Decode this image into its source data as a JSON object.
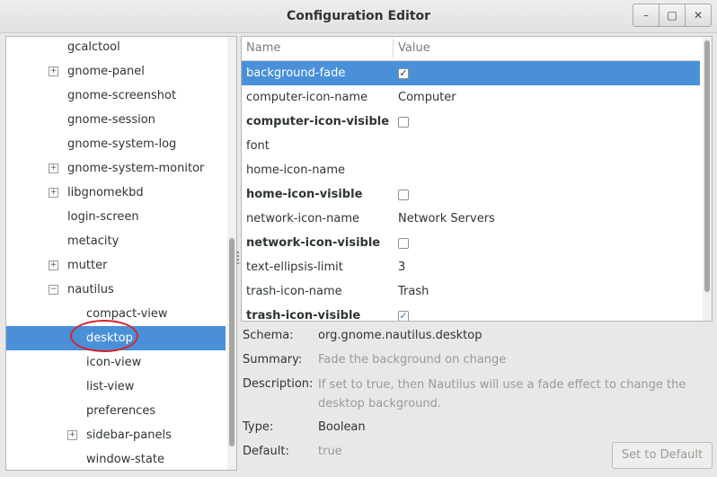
{
  "window": {
    "title": "Configuration Editor",
    "buttons": [
      {
        "name": "minimize",
        "glyph": "–"
      },
      {
        "name": "maximize",
        "glyph": "□"
      },
      {
        "name": "close",
        "glyph": "✕"
      }
    ]
  },
  "tree": {
    "items": [
      {
        "label": "gcalctool",
        "expander": false,
        "indent": 0
      },
      {
        "label": "gnome-panel",
        "expander": true,
        "indent": 0
      },
      {
        "label": "gnome-screenshot",
        "expander": false,
        "indent": 0
      },
      {
        "label": "gnome-session",
        "expander": false,
        "indent": 0
      },
      {
        "label": "gnome-system-log",
        "expander": false,
        "indent": 0
      },
      {
        "label": "gnome-system-monitor",
        "expander": true,
        "indent": 0
      },
      {
        "label": "libgnomekbd",
        "expander": true,
        "indent": 0
      },
      {
        "label": "login-screen",
        "expander": false,
        "indent": 0
      },
      {
        "label": "metacity",
        "expander": false,
        "indent": 0
      },
      {
        "label": "mutter",
        "expander": true,
        "indent": 0
      },
      {
        "label": "nautilus",
        "expander": "expanded",
        "indent": 0
      },
      {
        "label": "compact-view",
        "expander": false,
        "indent": 1
      },
      {
        "label": "desktop",
        "expander": false,
        "indent": 1,
        "selected": true
      },
      {
        "label": "icon-view",
        "expander": false,
        "indent": 1
      },
      {
        "label": "list-view",
        "expander": false,
        "indent": 1
      },
      {
        "label": "preferences",
        "expander": false,
        "indent": 1
      },
      {
        "label": "sidebar-panels",
        "expander": true,
        "indent": 1
      },
      {
        "label": "window-state",
        "expander": false,
        "indent": 1
      }
    ]
  },
  "grid": {
    "columns": {
      "name": "Name",
      "value": "Value"
    },
    "rows": [
      {
        "name": "background-fade",
        "type": "bool",
        "checked": true,
        "bold": false,
        "selected": true
      },
      {
        "name": "computer-icon-name",
        "type": "text",
        "value": "Computer",
        "bold": false
      },
      {
        "name": "computer-icon-visible",
        "type": "bool",
        "checked": false,
        "bold": true
      },
      {
        "name": "font",
        "type": "text",
        "value": "",
        "bold": false
      },
      {
        "name": "home-icon-name",
        "type": "text",
        "value": "",
        "bold": false
      },
      {
        "name": "home-icon-visible",
        "type": "bool",
        "checked": false,
        "bold": true
      },
      {
        "name": "network-icon-name",
        "type": "text",
        "value": "Network Servers",
        "bold": false
      },
      {
        "name": "network-icon-visible",
        "type": "bool",
        "checked": false,
        "bold": true
      },
      {
        "name": "text-ellipsis-limit",
        "type": "text",
        "value": "3",
        "bold": false
      },
      {
        "name": "trash-icon-name",
        "type": "text",
        "value": "Trash",
        "bold": false
      },
      {
        "name": "trash-icon-visible",
        "type": "bool",
        "checked": true,
        "bold": true
      }
    ]
  },
  "details": {
    "schema_label": "Schema:",
    "schema": "org.gnome.nautilus.desktop",
    "summary_label": "Summary:",
    "summary": "Fade the background on change",
    "description_label": "Description:",
    "description": "If set to true, then Nautilus will use a fade effect to change the desktop background.",
    "type_label": "Type:",
    "type": "Boolean",
    "default_label": "Default:",
    "default": "true",
    "set_default_label": "Set to Default"
  },
  "colors": {
    "selection": "#4a90d9",
    "annotation": "#d8222a"
  }
}
